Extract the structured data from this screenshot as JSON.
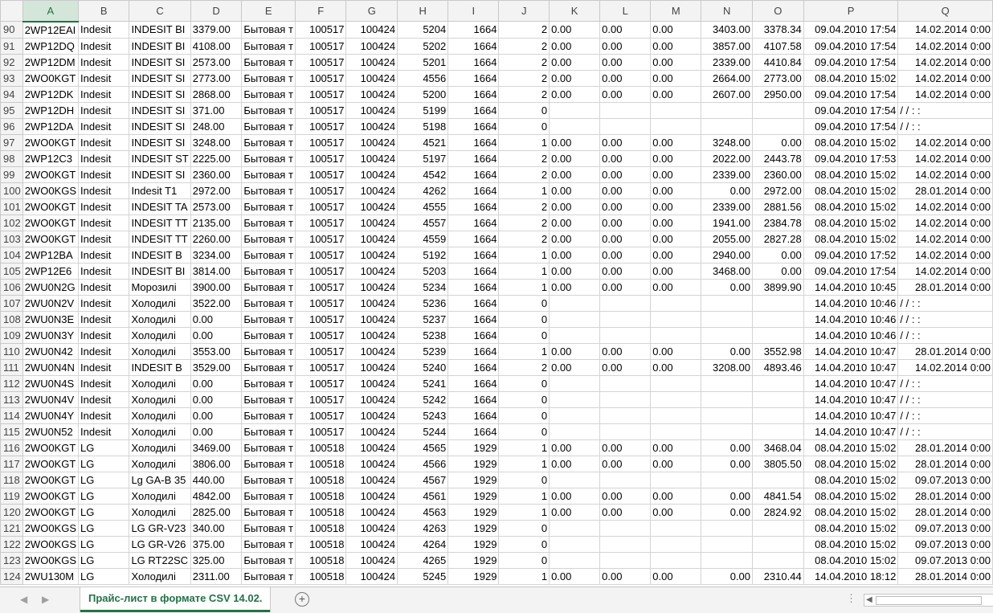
{
  "columns": [
    "A",
    "B",
    "C",
    "D",
    "E",
    "F",
    "G",
    "H",
    "I",
    "J",
    "K",
    "L",
    "M",
    "N",
    "O",
    "P",
    "Q"
  ],
  "selected_column": "A",
  "rows": [
    {
      "n": "90",
      "A": "2WP12EAI",
      "B": "Indesit",
      "C": "INDESIT BI",
      "D": "3379.00",
      "E": "Бытовая т",
      "F": "100517",
      "G": "100424",
      "H": "5204",
      "I": "1664",
      "J": "2",
      "K": "0.00",
      "L": "0.00",
      "M": "0.00",
      "N": "3403.00",
      "O": "3378.34",
      "P": "09.04.2010 17:54",
      "Q": "14.02.2014 0:00"
    },
    {
      "n": "91",
      "A": "2WP12DQ",
      "B": "Indesit",
      "C": "INDESIT BI",
      "D": "4108.00",
      "E": "Бытовая т",
      "F": "100517",
      "G": "100424",
      "H": "5202",
      "I": "1664",
      "J": "2",
      "K": "0.00",
      "L": "0.00",
      "M": "0.00",
      "N": "3857.00",
      "O": "4107.58",
      "P": "09.04.2010 17:54",
      "Q": "14.02.2014 0:00"
    },
    {
      "n": "92",
      "A": "2WP12DM",
      "B": "Indesit",
      "C": "INDESIT SI",
      "D": "2573.00",
      "E": "Бытовая т",
      "F": "100517",
      "G": "100424",
      "H": "5201",
      "I": "1664",
      "J": "2",
      "K": "0.00",
      "L": "0.00",
      "M": "0.00",
      "N": "2339.00",
      "O": "4410.84",
      "P": "09.04.2010 17:54",
      "Q": "14.02.2014 0:00"
    },
    {
      "n": "93",
      "A": "2WO0KGT",
      "B": "Indesit",
      "C": "INDESIT SI",
      "D": "2773.00",
      "E": "Бытовая т",
      "F": "100517",
      "G": "100424",
      "H": "4556",
      "I": "1664",
      "J": "2",
      "K": "0.00",
      "L": "0.00",
      "M": "0.00",
      "N": "2664.00",
      "O": "2773.00",
      "P": "08.04.2010 15:02",
      "Q": "14.02.2014 0:00"
    },
    {
      "n": "94",
      "A": "2WP12DK",
      "B": "Indesit",
      "C": "INDESIT SI",
      "D": "2868.00",
      "E": "Бытовая т",
      "F": "100517",
      "G": "100424",
      "H": "5200",
      "I": "1664",
      "J": "2",
      "K": "0.00",
      "L": "0.00",
      "M": "0.00",
      "N": "2607.00",
      "O": "2950.00",
      "P": "09.04.2010 17:54",
      "Q": "14.02.2014 0:00"
    },
    {
      "n": "95",
      "A": "2WP12DH",
      "B": "Indesit",
      "C": "INDESIT SI",
      "D": "371.00",
      "E": "Бытовая т",
      "F": "100517",
      "G": "100424",
      "H": "5199",
      "I": "1664",
      "J": "0",
      "K": "",
      "L": "",
      "M": "",
      "N": "",
      "O": "",
      "P": "09.04.2010 17:54",
      "Q": "/  /     :  :"
    },
    {
      "n": "96",
      "A": "2WP12DA",
      "B": "Indesit",
      "C": "INDESIT SI",
      "D": "248.00",
      "E": "Бытовая т",
      "F": "100517",
      "G": "100424",
      "H": "5198",
      "I": "1664",
      "J": "0",
      "K": "",
      "L": "",
      "M": "",
      "N": "",
      "O": "",
      "P": "09.04.2010 17:54",
      "Q": "/  /     :  :"
    },
    {
      "n": "97",
      "A": "2WO0KGT",
      "B": "Indesit",
      "C": "INDESIT SI",
      "D": "3248.00",
      "E": "Бытовая т",
      "F": "100517",
      "G": "100424",
      "H": "4521",
      "I": "1664",
      "J": "1",
      "K": "0.00",
      "L": "0.00",
      "M": "0.00",
      "N": "3248.00",
      "O": "0.00",
      "P": "08.04.2010 15:02",
      "Q": "14.02.2014 0:00"
    },
    {
      "n": "98",
      "A": "2WP12C3",
      "B": "Indesit",
      "C": "INDESIT ST",
      "D": "2225.00",
      "E": "Бытовая т",
      "F": "100517",
      "G": "100424",
      "H": "5197",
      "I": "1664",
      "J": "2",
      "K": "0.00",
      "L": "0.00",
      "M": "0.00",
      "N": "2022.00",
      "O": "2443.78",
      "P": "09.04.2010 17:53",
      "Q": "14.02.2014 0:00"
    },
    {
      "n": "99",
      "A": "2WO0KGT",
      "B": "Indesit",
      "C": "INDESIT SI",
      "D": "2360.00",
      "E": "Бытовая т",
      "F": "100517",
      "G": "100424",
      "H": "4542",
      "I": "1664",
      "J": "2",
      "K": "0.00",
      "L": "0.00",
      "M": "0.00",
      "N": "2339.00",
      "O": "2360.00",
      "P": "08.04.2010 15:02",
      "Q": "14.02.2014 0:00"
    },
    {
      "n": "100",
      "A": "2WO0KGS",
      "B": "Indesit",
      "C": "Indesit T1",
      "D": "2972.00",
      "E": "Бытовая т",
      "F": "100517",
      "G": "100424",
      "H": "4262",
      "I": "1664",
      "J": "1",
      "K": "0.00",
      "L": "0.00",
      "M": "0.00",
      "N": "0.00",
      "O": "2972.00",
      "P": "08.04.2010 15:02",
      "Q": "28.01.2014 0:00"
    },
    {
      "n": "101",
      "A": "2WO0KGT",
      "B": "Indesit",
      "C": "INDESIT TA",
      "D": "2573.00",
      "E": "Бытовая т",
      "F": "100517",
      "G": "100424",
      "H": "4555",
      "I": "1664",
      "J": "2",
      "K": "0.00",
      "L": "0.00",
      "M": "0.00",
      "N": "2339.00",
      "O": "2881.56",
      "P": "08.04.2010 15:02",
      "Q": "14.02.2014 0:00"
    },
    {
      "n": "102",
      "A": "2WO0KGT",
      "B": "Indesit",
      "C": "INDESIT TT",
      "D": "2135.00",
      "E": "Бытовая т",
      "F": "100517",
      "G": "100424",
      "H": "4557",
      "I": "1664",
      "J": "2",
      "K": "0.00",
      "L": "0.00",
      "M": "0.00",
      "N": "1941.00",
      "O": "2384.78",
      "P": "08.04.2010 15:02",
      "Q": "14.02.2014 0:00"
    },
    {
      "n": "103",
      "A": "2WO0KGT",
      "B": "Indesit",
      "C": "INDESIT TT",
      "D": "2260.00",
      "E": "Бытовая т",
      "F": "100517",
      "G": "100424",
      "H": "4559",
      "I": "1664",
      "J": "2",
      "K": "0.00",
      "L": "0.00",
      "M": "0.00",
      "N": "2055.00",
      "O": "2827.28",
      "P": "08.04.2010 15:02",
      "Q": "14.02.2014 0:00"
    },
    {
      "n": "104",
      "A": "2WP12BA",
      "B": "Indesit",
      "C": "INDESIT B",
      "D": "3234.00",
      "E": "Бытовая т",
      "F": "100517",
      "G": "100424",
      "H": "5192",
      "I": "1664",
      "J": "1",
      "K": "0.00",
      "L": "0.00",
      "M": "0.00",
      "N": "2940.00",
      "O": "0.00",
      "P": "09.04.2010 17:52",
      "Q": "14.02.2014 0:00"
    },
    {
      "n": "105",
      "A": "2WP12E6",
      "B": "Indesit",
      "C": "INDESIT BI",
      "D": "3814.00",
      "E": "Бытовая т",
      "F": "100517",
      "G": "100424",
      "H": "5203",
      "I": "1664",
      "J": "1",
      "K": "0.00",
      "L": "0.00",
      "M": "0.00",
      "N": "3468.00",
      "O": "0.00",
      "P": "09.04.2010 17:54",
      "Q": "14.02.2014 0:00"
    },
    {
      "n": "106",
      "A": "2WU0N2G",
      "B": "Indesit",
      "C": "Морозилі",
      "D": "3900.00",
      "E": "Бытовая т",
      "F": "100517",
      "G": "100424",
      "H": "5234",
      "I": "1664",
      "J": "1",
      "K": "0.00",
      "L": "0.00",
      "M": "0.00",
      "N": "0.00",
      "O": "3899.90",
      "P": "14.04.2010 10:45",
      "Q": "28.01.2014 0:00"
    },
    {
      "n": "107",
      "A": "2WU0N2V",
      "B": "Indesit",
      "C": "Холодилі",
      "D": "3522.00",
      "E": "Бытовая т",
      "F": "100517",
      "G": "100424",
      "H": "5236",
      "I": "1664",
      "J": "0",
      "K": "",
      "L": "",
      "M": "",
      "N": "",
      "O": "",
      "P": "14.04.2010 10:46",
      "Q": "/  /     :  :"
    },
    {
      "n": "108",
      "A": "2WU0N3E",
      "B": "Indesit",
      "C": "Холодилі",
      "D": "0.00",
      "E": "Бытовая т",
      "F": "100517",
      "G": "100424",
      "H": "5237",
      "I": "1664",
      "J": "0",
      "K": "",
      "L": "",
      "M": "",
      "N": "",
      "O": "",
      "P": "14.04.2010 10:46",
      "Q": "/  /     :  :"
    },
    {
      "n": "109",
      "A": "2WU0N3Y",
      "B": "Indesit",
      "C": "Холодилі",
      "D": "0.00",
      "E": "Бытовая т",
      "F": "100517",
      "G": "100424",
      "H": "5238",
      "I": "1664",
      "J": "0",
      "K": "",
      "L": "",
      "M": "",
      "N": "",
      "O": "",
      "P": "14.04.2010 10:46",
      "Q": "/  /     :  :"
    },
    {
      "n": "110",
      "A": "2WU0N42",
      "B": "Indesit",
      "C": "Холодилі",
      "D": "3553.00",
      "E": "Бытовая т",
      "F": "100517",
      "G": "100424",
      "H": "5239",
      "I": "1664",
      "J": "1",
      "K": "0.00",
      "L": "0.00",
      "M": "0.00",
      "N": "0.00",
      "O": "3552.98",
      "P": "14.04.2010 10:47",
      "Q": "28.01.2014 0:00"
    },
    {
      "n": "111",
      "A": "2WU0N4N",
      "B": "Indesit",
      "C": "INDESIT B",
      "D": "3529.00",
      "E": "Бытовая т",
      "F": "100517",
      "G": "100424",
      "H": "5240",
      "I": "1664",
      "J": "2",
      "K": "0.00",
      "L": "0.00",
      "M": "0.00",
      "N": "3208.00",
      "O": "4893.46",
      "P": "14.04.2010 10:47",
      "Q": "14.02.2014 0:00"
    },
    {
      "n": "112",
      "A": "2WU0N4S",
      "B": "Indesit",
      "C": "Холодилі",
      "D": "0.00",
      "E": "Бытовая т",
      "F": "100517",
      "G": "100424",
      "H": "5241",
      "I": "1664",
      "J": "0",
      "K": "",
      "L": "",
      "M": "",
      "N": "",
      "O": "",
      "P": "14.04.2010 10:47",
      "Q": "/  /     :  :"
    },
    {
      "n": "113",
      "A": "2WU0N4V",
      "B": "Indesit",
      "C": "Холодилі",
      "D": "0.00",
      "E": "Бытовая т",
      "F": "100517",
      "G": "100424",
      "H": "5242",
      "I": "1664",
      "J": "0",
      "K": "",
      "L": "",
      "M": "",
      "N": "",
      "O": "",
      "P": "14.04.2010 10:47",
      "Q": "/  /     :  :"
    },
    {
      "n": "114",
      "A": "2WU0N4Y",
      "B": "Indesit",
      "C": "Холодилі",
      "D": "0.00",
      "E": "Бытовая т",
      "F": "100517",
      "G": "100424",
      "H": "5243",
      "I": "1664",
      "J": "0",
      "K": "",
      "L": "",
      "M": "",
      "N": "",
      "O": "",
      "P": "14.04.2010 10:47",
      "Q": "/  /     :  :"
    },
    {
      "n": "115",
      "A": "2WU0N52",
      "B": "Indesit",
      "C": "Холодилі",
      "D": "0.00",
      "E": "Бытовая т",
      "F": "100517",
      "G": "100424",
      "H": "5244",
      "I": "1664",
      "J": "0",
      "K": "",
      "L": "",
      "M": "",
      "N": "",
      "O": "",
      "P": "14.04.2010 10:47",
      "Q": "/  /     :  :"
    },
    {
      "n": "116",
      "A": "2WO0KGT",
      "B": "LG",
      "C": "Холодилі",
      "D": "3469.00",
      "E": "Бытовая т",
      "F": "100518",
      "G": "100424",
      "H": "4565",
      "I": "1929",
      "J": "1",
      "K": "0.00",
      "L": "0.00",
      "M": "0.00",
      "N": "0.00",
      "O": "3468.04",
      "P": "08.04.2010 15:02",
      "Q": "28.01.2014 0:00"
    },
    {
      "n": "117",
      "A": "2WO0KGT",
      "B": "LG",
      "C": "Холодилі",
      "D": "3806.00",
      "E": "Бытовая т",
      "F": "100518",
      "G": "100424",
      "H": "4566",
      "I": "1929",
      "J": "1",
      "K": "0.00",
      "L": "0.00",
      "M": "0.00",
      "N": "0.00",
      "O": "3805.50",
      "P": "08.04.2010 15:02",
      "Q": "28.01.2014 0:00"
    },
    {
      "n": "118",
      "A": "2WO0KGT",
      "B": "LG",
      "C": "Lg GA-B 35",
      "D": "440.00",
      "E": "Бытовая т",
      "F": "100518",
      "G": "100424",
      "H": "4567",
      "I": "1929",
      "J": "0",
      "K": "",
      "L": "",
      "M": "",
      "N": "",
      "O": "",
      "P": "08.04.2010 15:02",
      "Q": "09.07.2013 0:00"
    },
    {
      "n": "119",
      "A": "2WO0KGT",
      "B": "LG",
      "C": "Холодилі",
      "D": "4842.00",
      "E": "Бытовая т",
      "F": "100518",
      "G": "100424",
      "H": "4561",
      "I": "1929",
      "J": "1",
      "K": "0.00",
      "L": "0.00",
      "M": "0.00",
      "N": "0.00",
      "O": "4841.54",
      "P": "08.04.2010 15:02",
      "Q": "28.01.2014 0:00"
    },
    {
      "n": "120",
      "A": "2WO0KGT",
      "B": "LG",
      "C": "Холодилі",
      "D": "2825.00",
      "E": "Бытовая т",
      "F": "100518",
      "G": "100424",
      "H": "4563",
      "I": "1929",
      "J": "1",
      "K": "0.00",
      "L": "0.00",
      "M": "0.00",
      "N": "0.00",
      "O": "2824.92",
      "P": "08.04.2010 15:02",
      "Q": "28.01.2014 0:00"
    },
    {
      "n": "121",
      "A": "2WO0KGS",
      "B": "LG",
      "C": "LG GR-V23",
      "D": "340.00",
      "E": "Бытовая т",
      "F": "100518",
      "G": "100424",
      "H": "4263",
      "I": "1929",
      "J": "0",
      "K": "",
      "L": "",
      "M": "",
      "N": "",
      "O": "",
      "P": "08.04.2010 15:02",
      "Q": "09.07.2013 0:00"
    },
    {
      "n": "122",
      "A": "2WO0KGS",
      "B": "LG",
      "C": "LG GR-V26",
      "D": "375.00",
      "E": "Бытовая т",
      "F": "100518",
      "G": "100424",
      "H": "4264",
      "I": "1929",
      "J": "0",
      "K": "",
      "L": "",
      "M": "",
      "N": "",
      "O": "",
      "P": "08.04.2010 15:02",
      "Q": "09.07.2013 0:00"
    },
    {
      "n": "123",
      "A": "2WO0KGS",
      "B": "LG",
      "C": "LG RT22SC",
      "D": "325.00",
      "E": "Бытовая т",
      "F": "100518",
      "G": "100424",
      "H": "4265",
      "I": "1929",
      "J": "0",
      "K": "",
      "L": "",
      "M": "",
      "N": "",
      "O": "",
      "P": "08.04.2010 15:02",
      "Q": "09.07.2013 0:00"
    },
    {
      "n": "124",
      "A": "2WU130M",
      "B": "LG",
      "C": "Холодилі",
      "D": "2311.00",
      "E": "Бытовая т",
      "F": "100518",
      "G": "100424",
      "H": "5245",
      "I": "1929",
      "J": "1",
      "K": "0.00",
      "L": "0.00",
      "M": "0.00",
      "N": "0.00",
      "O": "2310.44",
      "P": "14.04.2010 18:12",
      "Q": "28.01.2014 0:00"
    }
  ],
  "sheet_tab": "Прайс-лист в формате CSV 14.02.",
  "add_sheet": "+",
  "nav_prev": "◀",
  "nav_next": "▶",
  "options_dots": "⋮",
  "colors": {
    "accent": "#217346",
    "header_bg": "#f3f3f3",
    "selected_header_bg": "#d3e6d9"
  }
}
